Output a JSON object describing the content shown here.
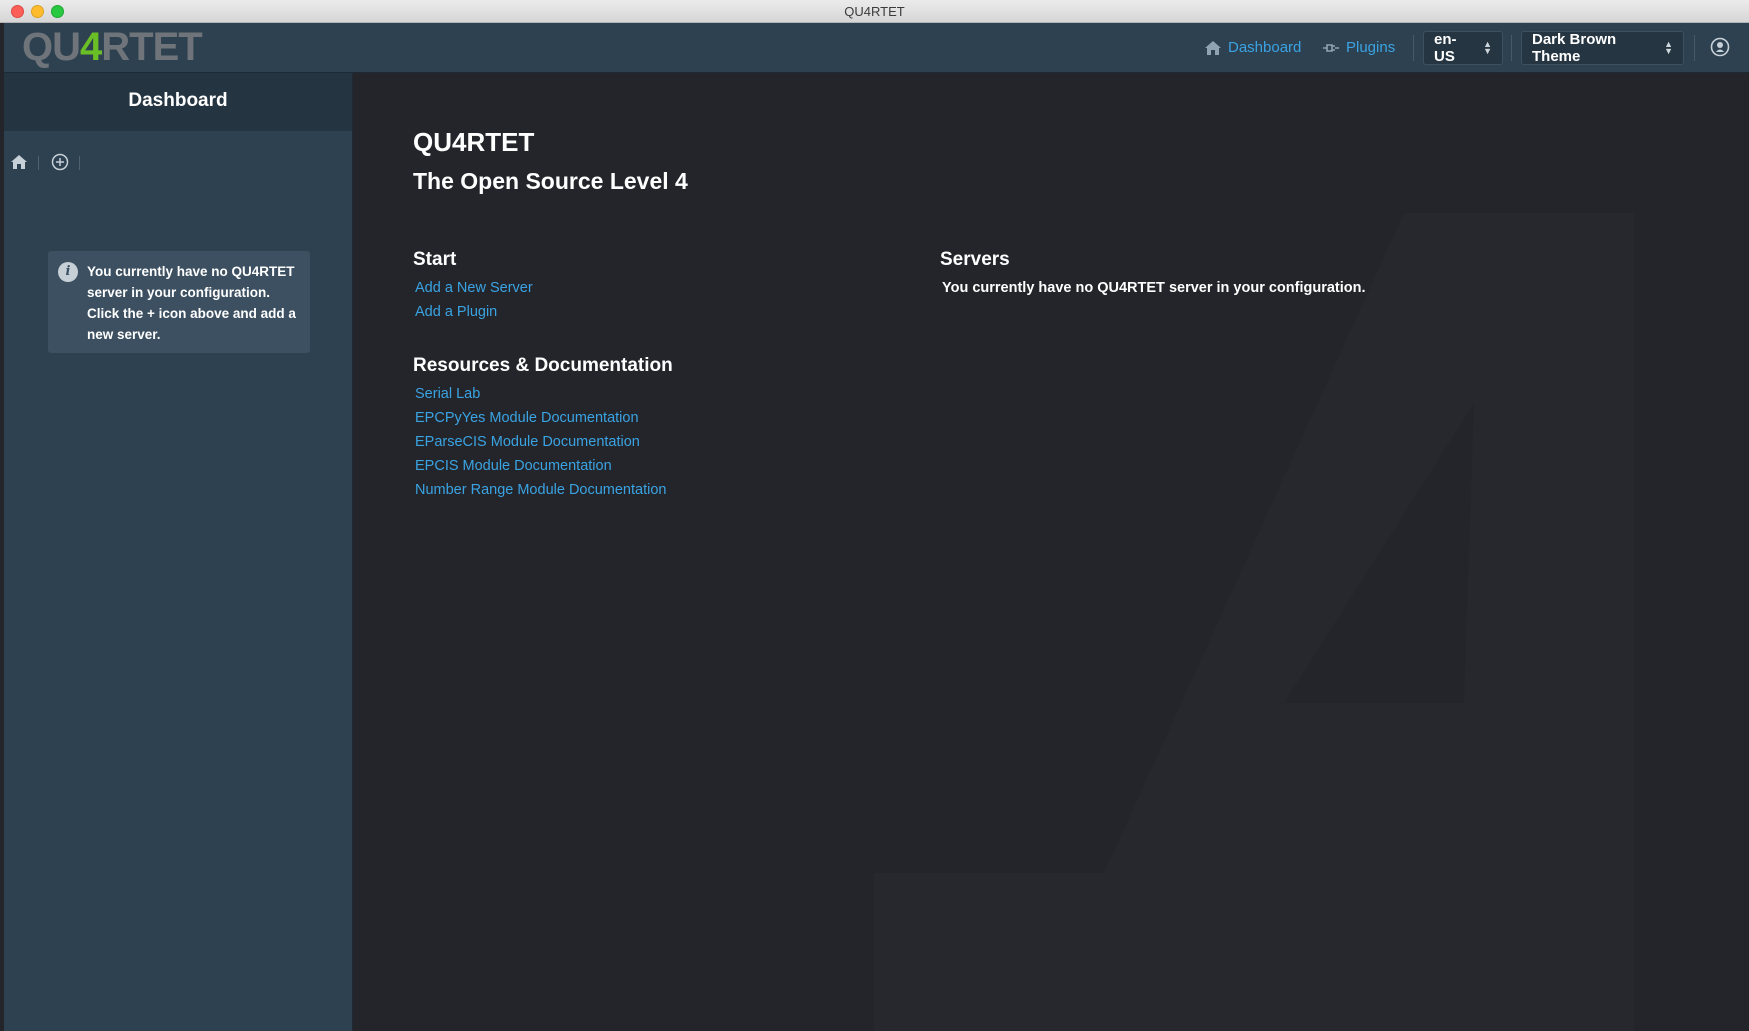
{
  "window": {
    "title": "QU4RTET"
  },
  "logo": {
    "text_before": "QU",
    "text_accent": "4",
    "text_after": "RTET",
    "accent_color": "#6bbf26"
  },
  "header": {
    "nav": [
      {
        "label": "Dashboard",
        "icon": "home-icon"
      },
      {
        "label": "Plugins",
        "icon": "plug-icon"
      }
    ],
    "language": {
      "selected": "en-US"
    },
    "theme": {
      "selected": "Dark Brown Theme"
    },
    "user_icon": "user-icon"
  },
  "sidebar": {
    "title": "Dashboard",
    "tools": [
      {
        "icon": "home-icon"
      },
      {
        "icon": "add-circle-icon"
      }
    ],
    "alert": "You currently have no QU4RTET server in your configuration. Click the + icon above and add a new server."
  },
  "main": {
    "title": "QU4RTET",
    "subtitle": "The Open Source Level 4",
    "start": {
      "heading": "Start",
      "links": [
        "Add a New Server",
        "Add a Plugin"
      ]
    },
    "resources": {
      "heading": "Resources & Documentation",
      "links": [
        "Serial Lab",
        "EPCPyYes Module Documentation",
        "EParseCIS Module Documentation",
        "EPCIS Module Documentation",
        "Number Range Module Documentation"
      ]
    },
    "servers": {
      "heading": "Servers",
      "empty_message": "You currently have no QU4RTET server in your configuration."
    }
  },
  "colors": {
    "link": "#3aa3e3",
    "sidebar_bg": "#2e4150",
    "main_bg": "#23252a"
  }
}
